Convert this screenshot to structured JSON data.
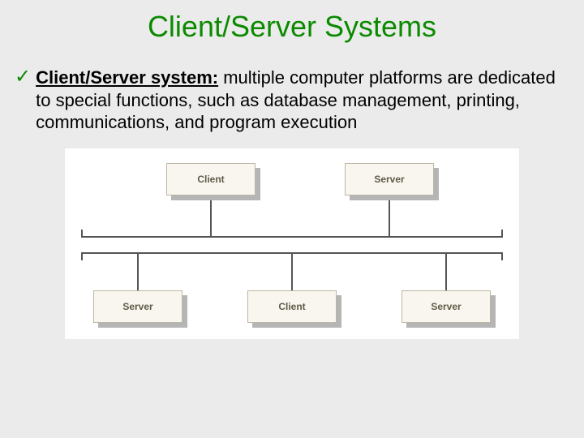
{
  "title": "Client/Server Systems",
  "bullet": {
    "check": "✓",
    "term": "Client/Server system:",
    "rest": " multiple computer platforms are dedicated to special functions, such as database management, printing, communications, and program execution"
  },
  "diagram": {
    "top_row": [
      {
        "label": "Client"
      },
      {
        "label": "Server"
      }
    ],
    "bottom_row": [
      {
        "label": "Server"
      },
      {
        "label": "Client"
      },
      {
        "label": "Server"
      }
    ]
  }
}
